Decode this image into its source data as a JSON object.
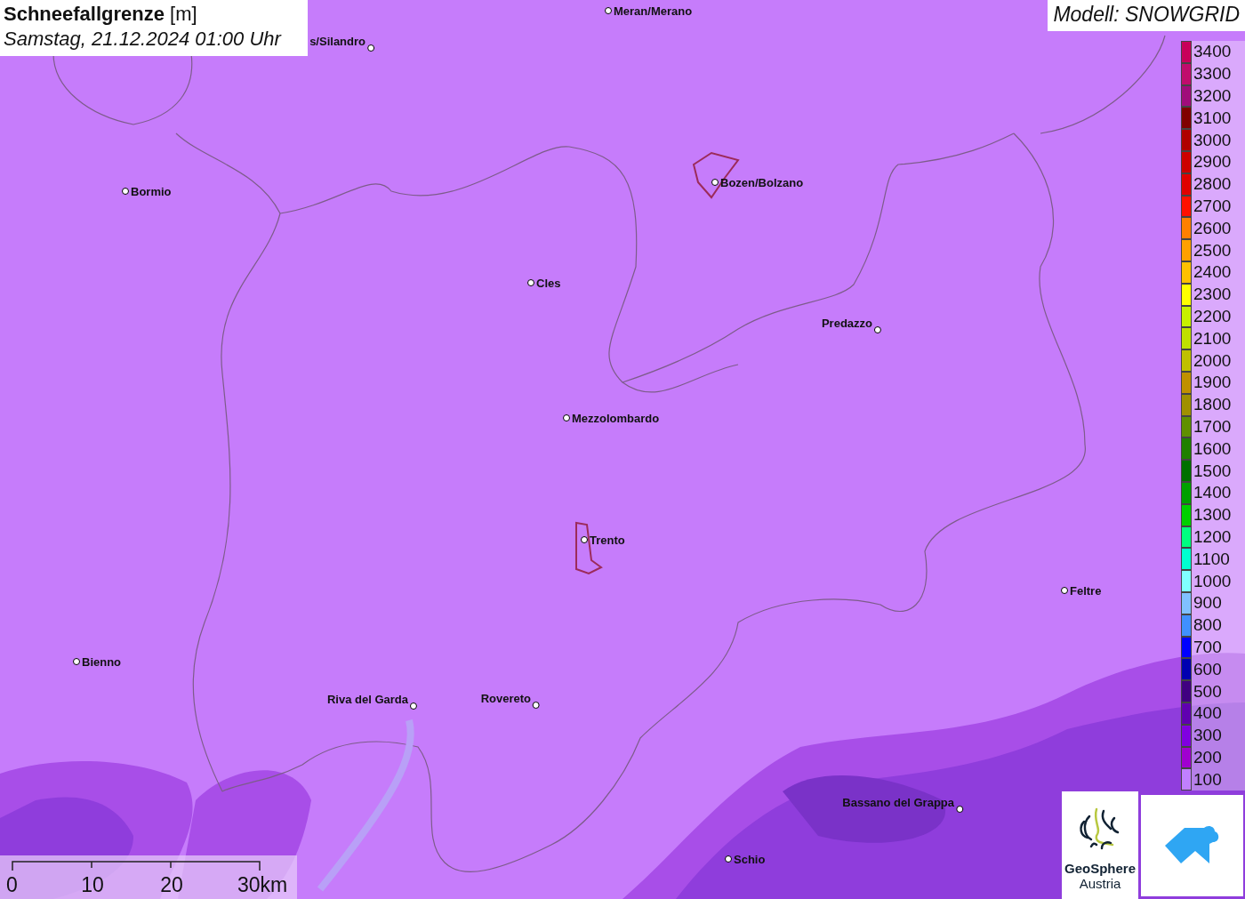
{
  "title": {
    "parameter": "Schneefallgrenze",
    "unit": "[m]",
    "datetime": "Samstag, 21.12.2024 01:00 Uhr"
  },
  "model": "Modell: SNOWGRID",
  "cities": [
    {
      "name": "Meran/Merano"
    },
    {
      "name": "s/Silandro"
    },
    {
      "name": "Bormio"
    },
    {
      "name": "Bozen/Bolzano"
    },
    {
      "name": "Cles"
    },
    {
      "name": "Predazzo"
    },
    {
      "name": "Mezzolombardo"
    },
    {
      "name": "Trento"
    },
    {
      "name": "Feltre"
    },
    {
      "name": "Bienno"
    },
    {
      "name": "Riva del Garda"
    },
    {
      "name": "Rovereto"
    },
    {
      "name": "Bassano del Grappa"
    },
    {
      "name": "Schio"
    }
  ],
  "legend": [
    {
      "label": "3400",
      "color": "#c8005a"
    },
    {
      "label": "3300",
      "color": "#c00c6c"
    },
    {
      "label": "3200",
      "color": "#a00c7a"
    },
    {
      "label": "3100",
      "color": "#800000"
    },
    {
      "label": "3000",
      "color": "#b00000"
    },
    {
      "label": "2900",
      "color": "#cc0000"
    },
    {
      "label": "2800",
      "color": "#e00000"
    },
    {
      "label": "2700",
      "color": "#ff1000"
    },
    {
      "label": "2600",
      "color": "#ff8000"
    },
    {
      "label": "2500",
      "color": "#ffa000"
    },
    {
      "label": "2400",
      "color": "#ffc000"
    },
    {
      "label": "2300",
      "color": "#ffff00"
    },
    {
      "label": "2200",
      "color": "#c8f000"
    },
    {
      "label": "2100",
      "color": "#c0e000"
    },
    {
      "label": "2000",
      "color": "#c0c000"
    },
    {
      "label": "1900",
      "color": "#c09000"
    },
    {
      "label": "1800",
      "color": "#a09000"
    },
    {
      "label": "1700",
      "color": "#609000"
    },
    {
      "label": "1600",
      "color": "#208000"
    },
    {
      "label": "1500",
      "color": "#007000"
    },
    {
      "label": "1400",
      "color": "#00a000"
    },
    {
      "label": "1300",
      "color": "#00d000"
    },
    {
      "label": "1200",
      "color": "#00ff80"
    },
    {
      "label": "1100",
      "color": "#00ffd0"
    },
    {
      "label": "1000",
      "color": "#80ffff"
    },
    {
      "label": "900",
      "color": "#80c0ff"
    },
    {
      "label": "800",
      "color": "#4090ff"
    },
    {
      "label": "700",
      "color": "#0000ff"
    },
    {
      "label": "600",
      "color": "#0000b0"
    },
    {
      "label": "500",
      "color": "#400080"
    },
    {
      "label": "400",
      "color": "#6000b0"
    },
    {
      "label": "300",
      "color": "#8000e0"
    },
    {
      "label": "200",
      "color": "#a000d0"
    },
    {
      "label": "100",
      "color": "#c080ff"
    }
  ],
  "scale_bar": {
    "ticks": [
      "0",
      "10",
      "20",
      "30km"
    ]
  },
  "logo": {
    "line1": "GeoSphere",
    "line2": "Austria"
  }
}
